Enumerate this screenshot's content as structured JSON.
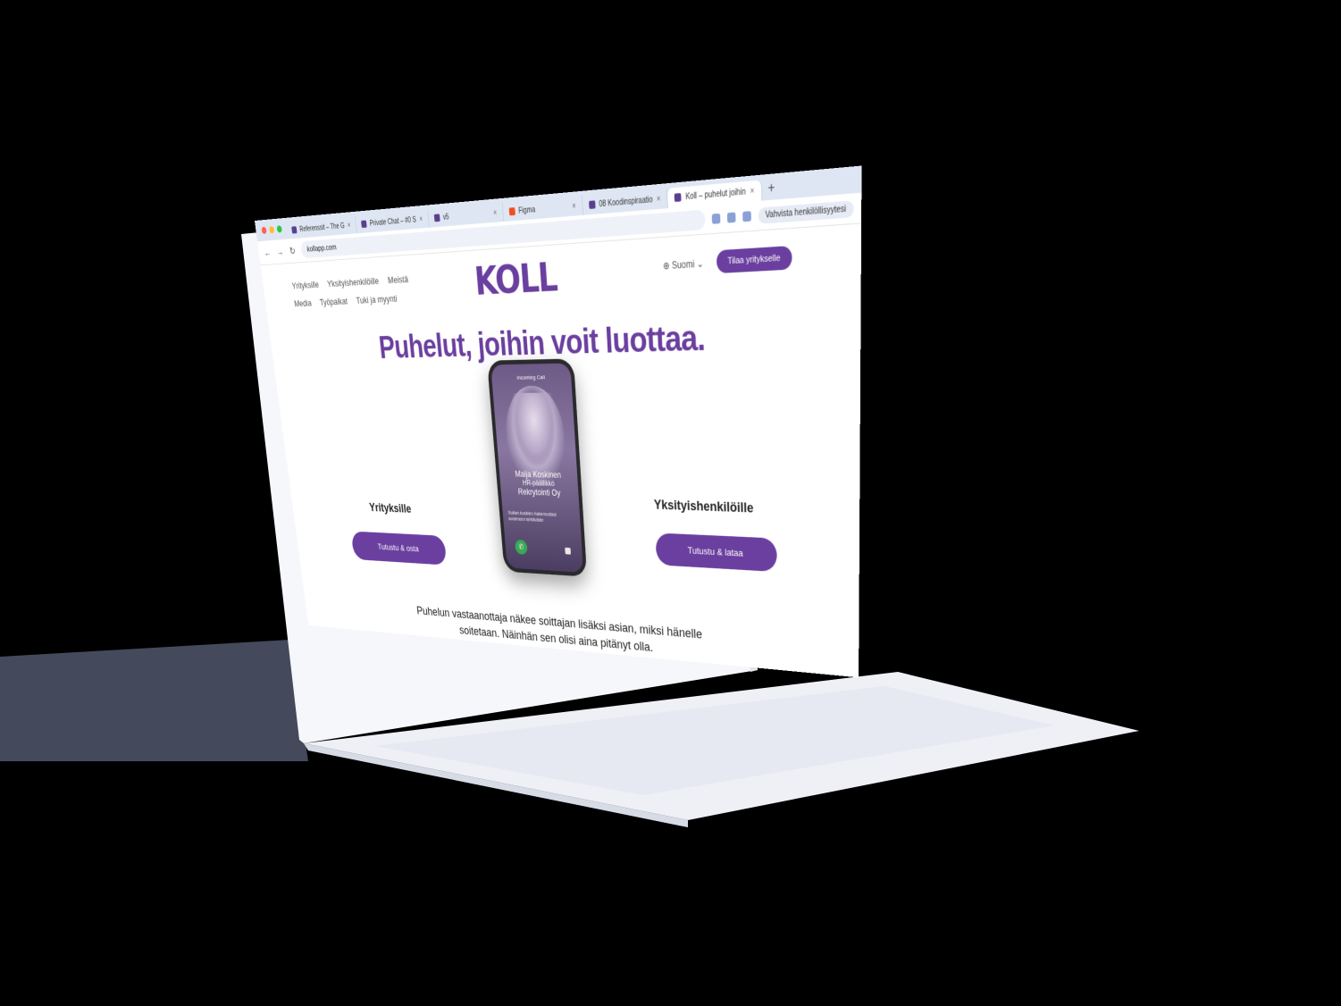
{
  "browser": {
    "tabs": [
      {
        "label": "Referenssit – The G"
      },
      {
        "label": "Private Chat – #0 S"
      },
      {
        "label": "v5"
      },
      {
        "label": "Figma"
      },
      {
        "label": "08 Koodinspiraatio"
      },
      {
        "label": "Koll – puhelut joihin"
      }
    ],
    "new_tab": "+",
    "url": "kollapp.com",
    "verify_label": "Vahvista henkilöllisyytesi"
  },
  "site": {
    "nav_row1": [
      "Yrityksille",
      "Yksityishenkilöille",
      "Meistä"
    ],
    "nav_row2": [
      "Media",
      "Työpaikat",
      "Tuki ja myynti"
    ],
    "logo": "KOLL",
    "language": "Suomi",
    "top_cta": "Tilaa yritykselle",
    "hero": "Puhelut, joihin voit luottaa.",
    "left_title": "Yrityksille",
    "left_button": "Tutustu & osta",
    "right_title": "Yksityishenkilöille",
    "right_button": "Tutustu & lataa",
    "tagline_line1": "Puhelun vastaanottaja näkee soittajan lisäksi asian, miksi hänelle",
    "tagline_line2": "soitetaan. Näinhän sen olisi aina pitänyt olla."
  },
  "phone": {
    "incoming": "Incoming Call",
    "caller_name": "Maija Koskinen",
    "caller_title": "HR-päällikkö",
    "caller_company": "Rekrytointi Oy",
    "reason": "Soitan koskien hakemustasi avoimeen tehtävään"
  },
  "colors": {
    "brand": "#6b3fa0",
    "background": "#000000"
  }
}
